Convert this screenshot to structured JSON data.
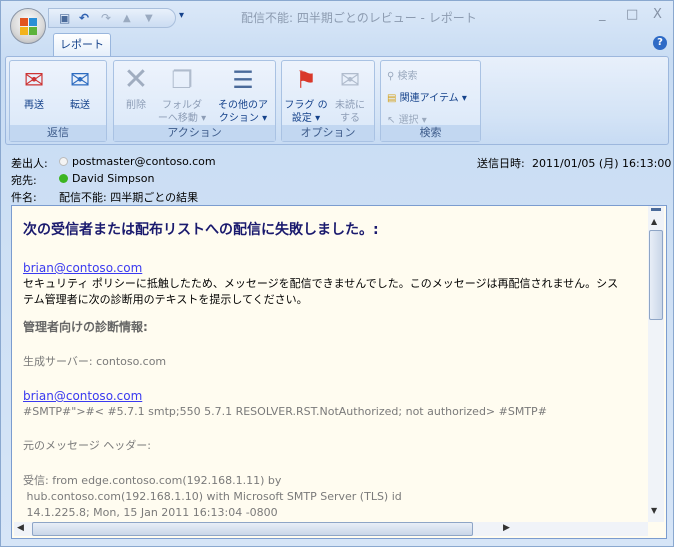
{
  "window": {
    "title": "配信不能: 四半期ごとのレビュー - レポート",
    "minimize": "_",
    "maximize": "□",
    "close": "X"
  },
  "qat": {
    "save": "save-icon",
    "undo": "undo-icon",
    "redo": "redo-icon",
    "up": "up-icon",
    "down": "down-icon",
    "customize": "▾"
  },
  "tab": {
    "label": "レポート"
  },
  "ribbon": {
    "groups": [
      {
        "label": "返信",
        "buttons": [
          {
            "label": "再送",
            "icon": "resend-icon"
          },
          {
            "label": "転送",
            "icon": "forward-icon"
          }
        ]
      },
      {
        "label": "アクション",
        "buttons": [
          {
            "label": "削除",
            "icon": "delete-icon"
          },
          {
            "label": "フォルダ ーへ移動 ▾",
            "icon": "move-folder-icon"
          },
          {
            "label": "その他のア クション ▾",
            "icon": "other-actions-icon"
          }
        ]
      },
      {
        "label": "オプション",
        "buttons": [
          {
            "label": "フラグ の設定 ▾",
            "icon": "flag-icon"
          },
          {
            "label": "未読に する",
            "icon": "mark-unread-icon"
          }
        ]
      },
      {
        "label": "検索",
        "buttons": [
          {
            "label": "検索",
            "icon": "binoculars-icon"
          },
          {
            "label": "関連アイテム ▾",
            "icon": "related-items-icon"
          },
          {
            "label": "選択 ▾",
            "icon": "select-icon"
          }
        ]
      }
    ]
  },
  "header": {
    "from_label": "差出人:",
    "from": "postmaster@contoso.com",
    "to_label": "宛先:",
    "to": "David Simpson",
    "subject_label": "件名:",
    "subject": "配信不能: 四半期ごとの結果",
    "sent_label": "送信日時:",
    "sent": "2011/01/05 (月) 16:13:00",
    "presence_to_color": "#3cb521"
  },
  "body": {
    "heading": "次の受信者または配布リストへの配信に失敗しました。:",
    "recipient": "brian@contoso.com",
    "message1": "セキュリティ ポリシーに抵触したため、メッセージを配信できませんでした。このメッセージは再配信されません。シス",
    "message2": "テム管理者に次の診断用のテキストを提示してください。",
    "diag_heading": "管理者向けの診断情報:",
    "server": "生成サーバー: contoso.com",
    "recipient2": "brian@contoso.com",
    "smtp": "#SMTP#\">#< #5.7.1 smtp;550 5.7.1 RESOLVER.RST.NotAuthorized; not authorized> #SMTP#",
    "orig_header": "元のメッセージ ヘッダー:",
    "recv1": "受信: from edge.contoso.com(192.168.1.11) by",
    "recv2": " hub.contoso.com(192.168.1.10) with Microsoft SMTP Server (TLS) id",
    "recv3": " 14.1.225.8; Mon, 15 Jan 2011 16:13:04 -0800"
  }
}
